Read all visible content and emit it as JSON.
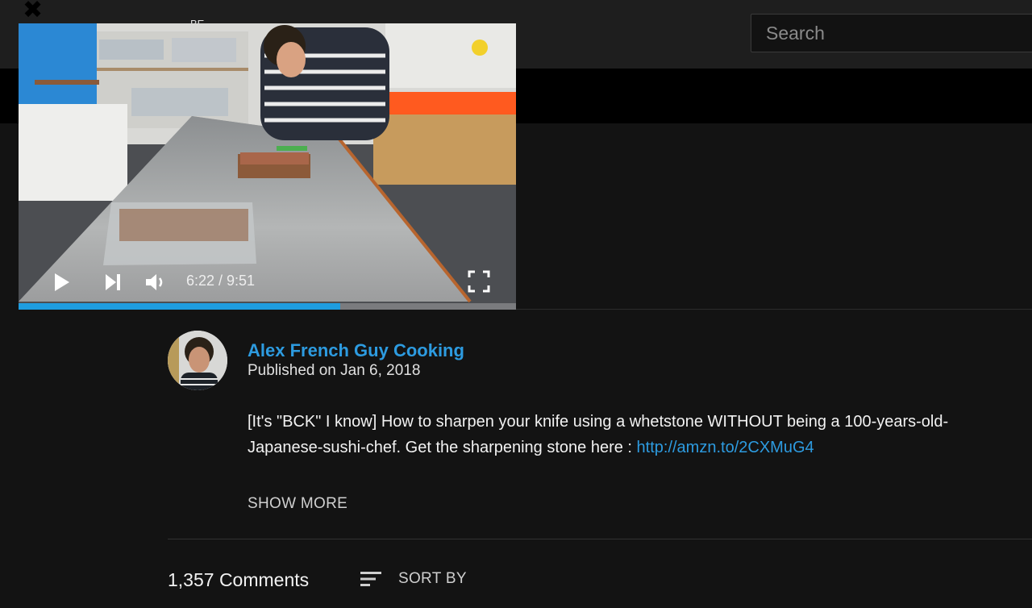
{
  "header": {
    "close_glyph": "✖",
    "logo_partial": "BE",
    "search_placeholder": "Search"
  },
  "player": {
    "time_label": "6:22 / 9:51",
    "progress": 0.646,
    "progress_color": "#1e9de0",
    "icons": [
      "play-icon",
      "next-icon",
      "volume-icon",
      "fullscreen-icon"
    ]
  },
  "video": {
    "channel_name": "Alex French Guy Cooking",
    "published": "Published on Jan 6, 2018",
    "description": "[It's \"BCK\" I know] How to sharpen your knife using a whetstone WITHOUT being a 100-years-old-Japanese-sushi-chef. Get the sharpening stone here : ",
    "description_link": "http://amzn.to/2CXMuG4",
    "show_more": "SHOW MORE"
  },
  "comments": {
    "count_label": "1,357 Comments",
    "sort_label": "SORT BY"
  },
  "colors": {
    "background": "#131313",
    "link": "#2d9be0",
    "accent": "#1e9de0"
  }
}
